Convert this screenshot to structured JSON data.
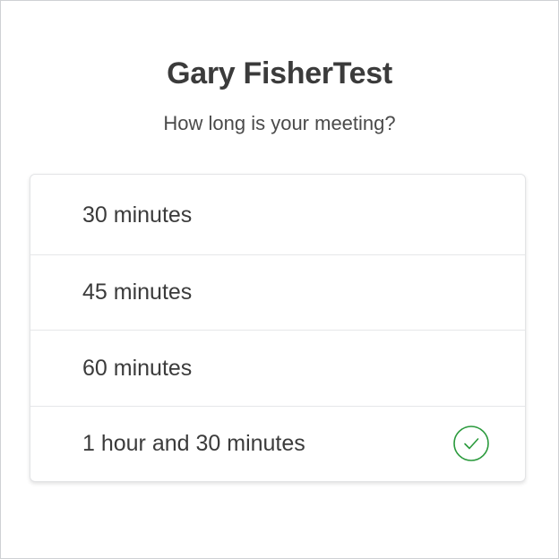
{
  "header": {
    "title": "Gary FisherTest",
    "subtitle": "How long is your meeting?"
  },
  "durations": [
    {
      "label": "30 minutes",
      "selected": false
    },
    {
      "label": "45 minutes",
      "selected": false
    },
    {
      "label": "60 minutes",
      "selected": false
    },
    {
      "label": "1 hour and 30 minutes",
      "selected": true
    }
  ],
  "icons": {
    "selected_indicator": "check-circle-icon"
  },
  "colors": {
    "check": "#2a9a3c",
    "text": "#3b3b3b"
  }
}
